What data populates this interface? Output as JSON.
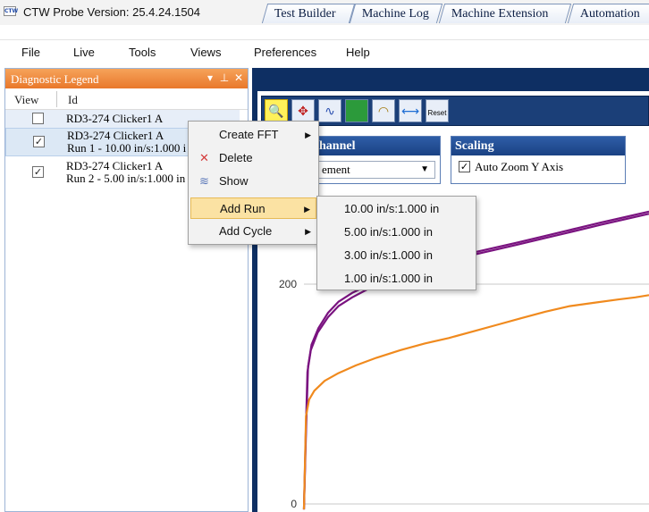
{
  "window": {
    "logo_text": "CTW",
    "title": "CTW Probe Version: 25.4.24.1504"
  },
  "menu": [
    "File",
    "Live",
    "Tools",
    "Views",
    "Preferences",
    "Help"
  ],
  "legend": {
    "title": "Diagnostic Legend",
    "col_view": "View",
    "col_id": "Id",
    "rows": [
      {
        "checked": false,
        "line1": "RD3-274 Clicker1 A",
        "line2": ""
      },
      {
        "checked": true,
        "line1": "RD3-274 Clicker1 A",
        "line2": "Run 1 - 10.00 in/s:1.000 i"
      },
      {
        "checked": true,
        "line1": "RD3-274 Clicker1 A",
        "line2": "Run 2 - 5.00 in/s:1.000 in"
      }
    ]
  },
  "tabs": [
    "Test Builder",
    "Machine Log",
    "Machine Extension",
    "Automation"
  ],
  "toolbar": {
    "reset_label": "Reset"
  },
  "channel": {
    "title": "hannel",
    "selected": "ement"
  },
  "scaling": {
    "title": "Scaling",
    "auto_zoom_label": "Auto Zoom Y Axis",
    "auto_zoom_checked": true
  },
  "context_menu": {
    "items": [
      {
        "label": "Create FFT",
        "submenu": true,
        "icon": ""
      },
      {
        "label": "Delete",
        "submenu": false,
        "icon": "delete-x-icon"
      },
      {
        "label": "Show",
        "submenu": false,
        "icon": "waveform-icon"
      },
      {
        "label": "Add Run",
        "submenu": true,
        "icon": "",
        "highlighted": true
      },
      {
        "label": "Add Cycle",
        "submenu": true,
        "icon": ""
      }
    ],
    "add_run_options": [
      "10.00 in/s:1.000 in",
      "5.00 in/s:1.000 in",
      "3.00 in/s:1.000 in",
      "1.00 in/s:1.000 in"
    ]
  },
  "chart_data": {
    "type": "line",
    "y_ticks": [
      200,
      0
    ],
    "colors": {
      "series_a": "#7a1380",
      "series_b": "#f08a1e"
    },
    "series": [
      {
        "color": "#7a1380",
        "points": [
          [
            0,
            -5
          ],
          [
            0.5,
            60
          ],
          [
            1,
            120
          ],
          [
            2,
            140
          ],
          [
            4,
            156
          ],
          [
            7,
            170
          ],
          [
            10,
            180
          ],
          [
            14,
            188
          ],
          [
            20,
            198
          ],
          [
            27,
            207
          ],
          [
            34,
            215
          ],
          [
            41,
            221
          ],
          [
            48,
            226
          ],
          [
            55,
            231
          ],
          [
            62,
            236
          ],
          [
            70,
            242
          ],
          [
            78,
            248
          ],
          [
            86,
            254
          ],
          [
            93,
            259
          ],
          [
            100,
            264
          ]
        ]
      },
      {
        "color": "#7a1380",
        "points": [
          [
            0,
            -5
          ],
          [
            0.6,
            65
          ],
          [
            1.2,
            125
          ],
          [
            2.2,
            145
          ],
          [
            4.2,
            160
          ],
          [
            7,
            174
          ],
          [
            10,
            184
          ],
          [
            14,
            192
          ],
          [
            20,
            201
          ],
          [
            27,
            210
          ],
          [
            34,
            217
          ],
          [
            41,
            223
          ],
          [
            48,
            228
          ],
          [
            55,
            233
          ],
          [
            62,
            238
          ],
          [
            70,
            244
          ],
          [
            78,
            250
          ],
          [
            86,
            256
          ],
          [
            93,
            261
          ],
          [
            100,
            266
          ]
        ]
      },
      {
        "color": "#f08a1e",
        "points": [
          [
            0,
            -5
          ],
          [
            0.6,
            80
          ],
          [
            1.5,
            95
          ],
          [
            3,
            103
          ],
          [
            6,
            112
          ],
          [
            10,
            119
          ],
          [
            15,
            126
          ],
          [
            21,
            133
          ],
          [
            28,
            140
          ],
          [
            35,
            146
          ],
          [
            42,
            151
          ],
          [
            49,
            157
          ],
          [
            56,
            163
          ],
          [
            63,
            169
          ],
          [
            70,
            175
          ],
          [
            77,
            180
          ],
          [
            84,
            183
          ],
          [
            91,
            186
          ],
          [
            96,
            188
          ],
          [
            100,
            190
          ]
        ]
      }
    ]
  }
}
